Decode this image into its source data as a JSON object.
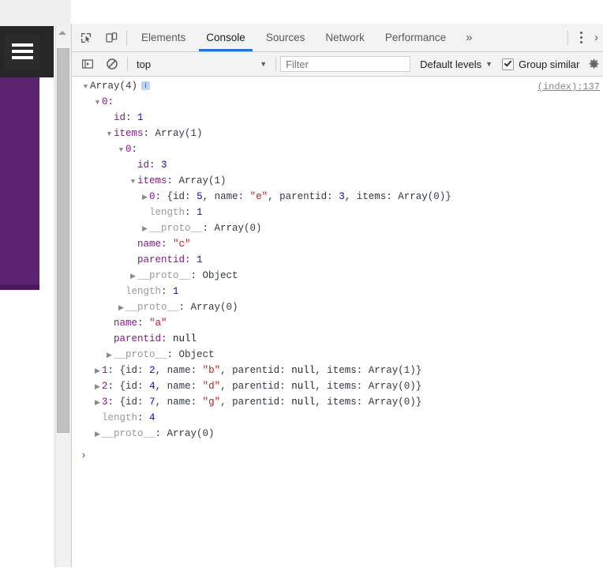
{
  "page": {
    "hamburger_icon": "hamburger-menu-icon",
    "side_panel_color": "#5c2171",
    "header_color": "#262626"
  },
  "devtools": {
    "tabstrip": {
      "inspect_icon": "inspect-element-icon",
      "device_toolbar_icon": "device-toolbar-icon",
      "tabs": [
        {
          "label": "Elements",
          "active": false
        },
        {
          "label": "Console",
          "active": true
        },
        {
          "label": "Sources",
          "active": false
        },
        {
          "label": "Network",
          "active": false
        },
        {
          "label": "Performance",
          "active": false
        }
      ],
      "overflow_label": "»",
      "more_options_icon": "vertical-dots-icon",
      "close_label": "›",
      "active_tab_color": "#1a73e8"
    },
    "filterbar": {
      "sidebar_toggle_icon": "console-sidebar-icon",
      "clear_console_icon": "clear-console-icon",
      "context_value": "top",
      "context_caret": "▼",
      "filter_placeholder": "Filter",
      "filter_value": "",
      "levels_value": "Default levels",
      "levels_caret": "▼",
      "group_similar_label": "Group similar",
      "group_similar_checked": true,
      "settings_icon": "gear-icon"
    },
    "console": {
      "source_link": "(index):137",
      "prompt_caret": "›",
      "info_badge": "i",
      "lines": [
        {
          "indent": 0,
          "tri": "▼",
          "parts": [
            {
              "t": "Array(4)",
              "c": "plain"
            }
          ],
          "badge": true
        },
        {
          "indent": 1,
          "tri": "▼",
          "parts": [
            {
              "t": "0",
              "c": "key"
            },
            {
              "t": ":",
              "c": "plain"
            }
          ]
        },
        {
          "indent": 2,
          "tri": "",
          "parts": [
            {
              "t": "id",
              "c": "key"
            },
            {
              "t": ": ",
              "c": "plain"
            },
            {
              "t": "1",
              "c": "num"
            }
          ]
        },
        {
          "indent": 2,
          "tri": "▼",
          "parts": [
            {
              "t": "items",
              "c": "key"
            },
            {
              "t": ": ",
              "c": "plain"
            },
            {
              "t": "Array(1)",
              "c": "plain"
            }
          ]
        },
        {
          "indent": 3,
          "tri": "▼",
          "parts": [
            {
              "t": "0",
              "c": "key"
            },
            {
              "t": ":",
              "c": "plain"
            }
          ]
        },
        {
          "indent": 4,
          "tri": "",
          "parts": [
            {
              "t": "id",
              "c": "key"
            },
            {
              "t": ": ",
              "c": "plain"
            },
            {
              "t": "3",
              "c": "num"
            }
          ]
        },
        {
          "indent": 4,
          "tri": "▼",
          "parts": [
            {
              "t": "items",
              "c": "key"
            },
            {
              "t": ": ",
              "c": "plain"
            },
            {
              "t": "Array(1)",
              "c": "plain"
            }
          ]
        },
        {
          "indent": 5,
          "tri": "▶",
          "parts": [
            {
              "t": "0",
              "c": "key"
            },
            {
              "t": ": {",
              "c": "plain"
            },
            {
              "t": "id",
              "c": "plain"
            },
            {
              "t": ": ",
              "c": "plain"
            },
            {
              "t": "5",
              "c": "num"
            },
            {
              "t": ", ",
              "c": "plain"
            },
            {
              "t": "name",
              "c": "plain"
            },
            {
              "t": ": ",
              "c": "plain"
            },
            {
              "t": "\"e\"",
              "c": "str"
            },
            {
              "t": ", ",
              "c": "plain"
            },
            {
              "t": "parentid",
              "c": "plain"
            },
            {
              "t": ": ",
              "c": "plain"
            },
            {
              "t": "3",
              "c": "num"
            },
            {
              "t": ", ",
              "c": "plain"
            },
            {
              "t": "items",
              "c": "plain"
            },
            {
              "t": ": ",
              "c": "plain"
            },
            {
              "t": "Array(0)",
              "c": "plain"
            },
            {
              "t": "}",
              "c": "plain"
            }
          ]
        },
        {
          "indent": 5,
          "tri": "",
          "parts": [
            {
              "t": "length",
              "c": "muted"
            },
            {
              "t": ": ",
              "c": "plain"
            },
            {
              "t": "1",
              "c": "num"
            }
          ]
        },
        {
          "indent": 5,
          "tri": "▶",
          "parts": [
            {
              "t": "__proto__",
              "c": "muted"
            },
            {
              "t": ": ",
              "c": "plain"
            },
            {
              "t": "Array(0)",
              "c": "plain"
            }
          ]
        },
        {
          "indent": 4,
          "tri": "",
          "parts": [
            {
              "t": "name",
              "c": "key"
            },
            {
              "t": ": ",
              "c": "plain"
            },
            {
              "t": "\"c\"",
              "c": "str"
            }
          ]
        },
        {
          "indent": 4,
          "tri": "",
          "parts": [
            {
              "t": "parentid",
              "c": "key"
            },
            {
              "t": ": ",
              "c": "plain"
            },
            {
              "t": "1",
              "c": "num"
            }
          ]
        },
        {
          "indent": 4,
          "tri": "▶",
          "parts": [
            {
              "t": "__proto__",
              "c": "muted"
            },
            {
              "t": ": ",
              "c": "plain"
            },
            {
              "t": "Object",
              "c": "plain"
            }
          ]
        },
        {
          "indent": 3,
          "tri": "",
          "parts": [
            {
              "t": "length",
              "c": "muted"
            },
            {
              "t": ": ",
              "c": "plain"
            },
            {
              "t": "1",
              "c": "num"
            }
          ]
        },
        {
          "indent": 3,
          "tri": "▶",
          "parts": [
            {
              "t": "__proto__",
              "c": "muted"
            },
            {
              "t": ": ",
              "c": "plain"
            },
            {
              "t": "Array(0)",
              "c": "plain"
            }
          ]
        },
        {
          "indent": 2,
          "tri": "",
          "parts": [
            {
              "t": "name",
              "c": "key"
            },
            {
              "t": ": ",
              "c": "plain"
            },
            {
              "t": "\"a\"",
              "c": "str"
            }
          ]
        },
        {
          "indent": 2,
          "tri": "",
          "parts": [
            {
              "t": "parentid",
              "c": "key"
            },
            {
              "t": ": ",
              "c": "plain"
            },
            {
              "t": "null",
              "c": "nul"
            }
          ]
        },
        {
          "indent": 2,
          "tri": "▶",
          "parts": [
            {
              "t": "__proto__",
              "c": "muted"
            },
            {
              "t": ": ",
              "c": "plain"
            },
            {
              "t": "Object",
              "c": "plain"
            }
          ]
        },
        {
          "indent": 1,
          "tri": "▶",
          "parts": [
            {
              "t": "1",
              "c": "key"
            },
            {
              "t": ": {",
              "c": "plain"
            },
            {
              "t": "id",
              "c": "plain"
            },
            {
              "t": ": ",
              "c": "plain"
            },
            {
              "t": "2",
              "c": "num"
            },
            {
              "t": ", ",
              "c": "plain"
            },
            {
              "t": "name",
              "c": "plain"
            },
            {
              "t": ": ",
              "c": "plain"
            },
            {
              "t": "\"b\"",
              "c": "str"
            },
            {
              "t": ", ",
              "c": "plain"
            },
            {
              "t": "parentid",
              "c": "plain"
            },
            {
              "t": ": ",
              "c": "plain"
            },
            {
              "t": "null",
              "c": "nul"
            },
            {
              "t": ", ",
              "c": "plain"
            },
            {
              "t": "items",
              "c": "plain"
            },
            {
              "t": ": ",
              "c": "plain"
            },
            {
              "t": "Array(1)",
              "c": "plain"
            },
            {
              "t": "}",
              "c": "plain"
            }
          ]
        },
        {
          "indent": 1,
          "tri": "▶",
          "parts": [
            {
              "t": "2",
              "c": "key"
            },
            {
              "t": ": {",
              "c": "plain"
            },
            {
              "t": "id",
              "c": "plain"
            },
            {
              "t": ": ",
              "c": "plain"
            },
            {
              "t": "4",
              "c": "num"
            },
            {
              "t": ", ",
              "c": "plain"
            },
            {
              "t": "name",
              "c": "plain"
            },
            {
              "t": ": ",
              "c": "plain"
            },
            {
              "t": "\"d\"",
              "c": "str"
            },
            {
              "t": ", ",
              "c": "plain"
            },
            {
              "t": "parentid",
              "c": "plain"
            },
            {
              "t": ": ",
              "c": "plain"
            },
            {
              "t": "null",
              "c": "nul"
            },
            {
              "t": ", ",
              "c": "plain"
            },
            {
              "t": "items",
              "c": "plain"
            },
            {
              "t": ": ",
              "c": "plain"
            },
            {
              "t": "Array(0)",
              "c": "plain"
            },
            {
              "t": "}",
              "c": "plain"
            }
          ]
        },
        {
          "indent": 1,
          "tri": "▶",
          "parts": [
            {
              "t": "3",
              "c": "key"
            },
            {
              "t": ": {",
              "c": "plain"
            },
            {
              "t": "id",
              "c": "plain"
            },
            {
              "t": ": ",
              "c": "plain"
            },
            {
              "t": "7",
              "c": "num"
            },
            {
              "t": ", ",
              "c": "plain"
            },
            {
              "t": "name",
              "c": "plain"
            },
            {
              "t": ": ",
              "c": "plain"
            },
            {
              "t": "\"g\"",
              "c": "str"
            },
            {
              "t": ", ",
              "c": "plain"
            },
            {
              "t": "parentid",
              "c": "plain"
            },
            {
              "t": ": ",
              "c": "plain"
            },
            {
              "t": "null",
              "c": "nul"
            },
            {
              "t": ", ",
              "c": "plain"
            },
            {
              "t": "items",
              "c": "plain"
            },
            {
              "t": ": ",
              "c": "plain"
            },
            {
              "t": "Array(0)",
              "c": "plain"
            },
            {
              "t": "}",
              "c": "plain"
            }
          ]
        },
        {
          "indent": 1,
          "tri": "",
          "parts": [
            {
              "t": "length",
              "c": "muted"
            },
            {
              "t": ": ",
              "c": "plain"
            },
            {
              "t": "4",
              "c": "num"
            }
          ]
        },
        {
          "indent": 1,
          "tri": "▶",
          "parts": [
            {
              "t": "__proto__",
              "c": "muted"
            },
            {
              "t": ": ",
              "c": "plain"
            },
            {
              "t": "Array(0)",
              "c": "plain"
            }
          ]
        }
      ]
    }
  }
}
